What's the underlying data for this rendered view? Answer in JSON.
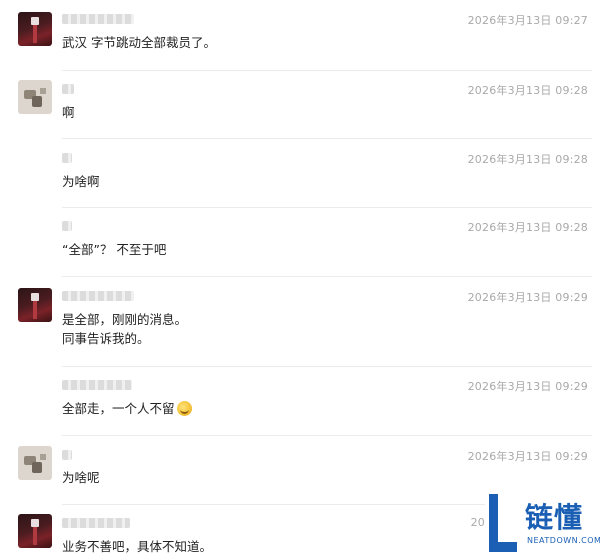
{
  "messages": [
    {
      "time": "2026年3月13日 09:27",
      "lines": [
        "武汉 字节跳动全部裁员了。"
      ]
    },
    {
      "time": "2026年3月13日 09:28",
      "lines": [
        "啊"
      ]
    },
    {
      "time": "2026年3月13日 09:28",
      "lines": [
        "为啥啊"
      ]
    },
    {
      "time": "2026年3月13日 09:28",
      "lines": [
        "“全部”？ 不至于吧"
      ]
    },
    {
      "time": "2026年3月13日 09:29",
      "lines": [
        "是全部，刚刚的消息。",
        "同事告诉我的。"
      ]
    },
    {
      "time": "2026年3月13日 09:29",
      "lines": [
        "全部走，一个人不留"
      ],
      "emoji": "grimace-emoji"
    },
    {
      "time": "2026年3月13日 09:29",
      "lines": [
        "为啥呢"
      ]
    },
    {
      "time": "20",
      "lines": [
        "业务不善吧，具体不知道。"
      ]
    }
  ],
  "watermark": {
    "brand": "链懂",
    "domain": "NEATDOWN.COM"
  }
}
